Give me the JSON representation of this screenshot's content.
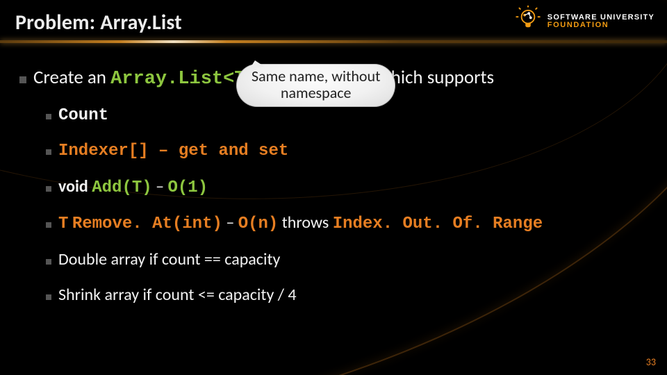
{
  "title": "Problem: Array.List",
  "logo": {
    "line1": "SOFTWARE UNIVERSITY",
    "line2": "FOUNDATION"
  },
  "main": {
    "prefix": "Create an ",
    "code": "Array.List<T>",
    "suffix": " data structure, which supports"
  },
  "bubble": {
    "line1": "Same name, without",
    "line2": "namespace"
  },
  "items": {
    "count": "Count",
    "indexer": "Indexer[] – get and set",
    "add_void": "void",
    "add_sig": "Add(T)",
    "add_dash": " – ",
    "add_big": "O(1)",
    "rm_t": "T",
    "rm_sig": "Remove. At(int)",
    "rm_dash": " – ",
    "rm_big": "O(n)",
    "rm_throws": " throws ",
    "rm_exc": "Index. Out. Of. Range",
    "double": "Double array if count == capacity",
    "shrink": "Shrink array if count <= capacity / 4"
  },
  "page": "33"
}
